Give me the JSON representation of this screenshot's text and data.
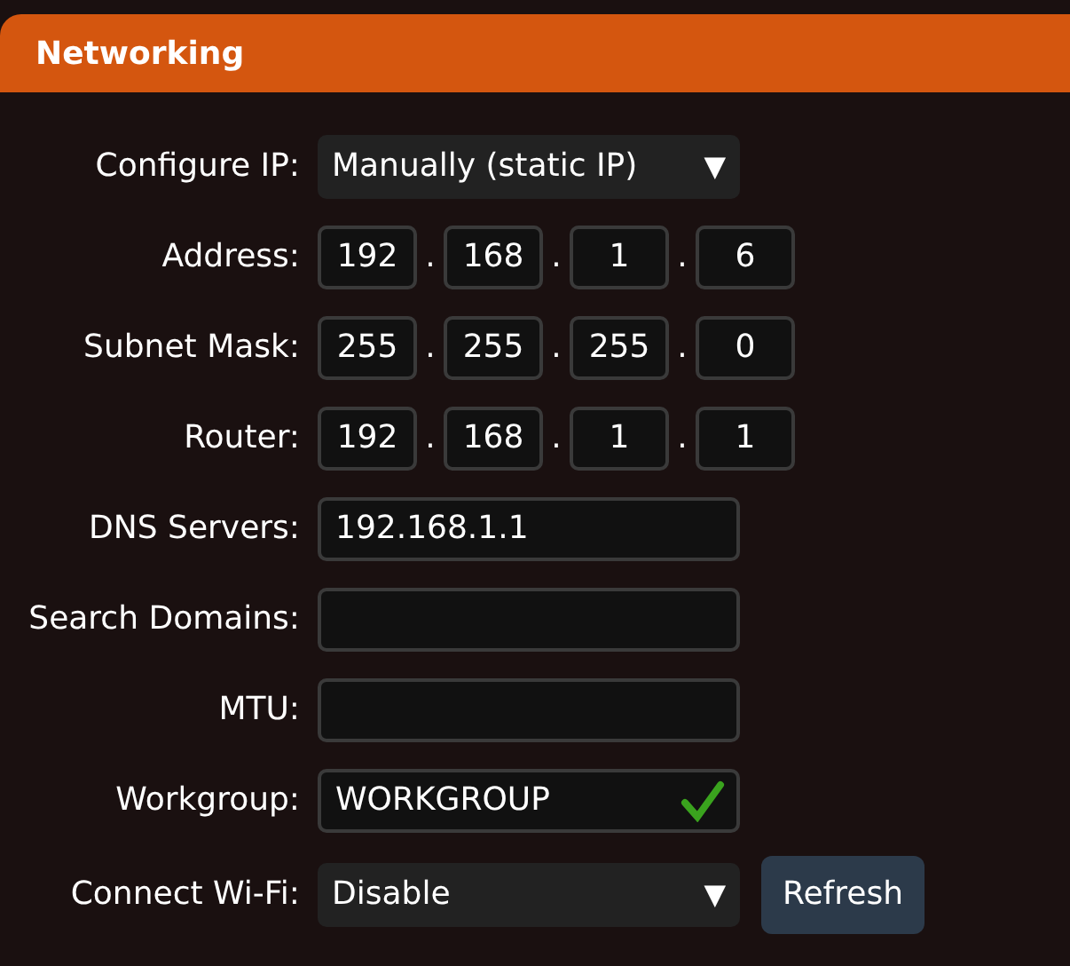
{
  "panel": {
    "title": "Networking"
  },
  "rows": [
    {
      "kind": "select",
      "label": "Configure IP:",
      "value": "Manually (static IP)",
      "arrow": "▼"
    },
    {
      "kind": "ip",
      "label": "Address:",
      "octets": [
        "192",
        "168",
        "1",
        "6"
      ],
      "separators": [
        ".",
        ".",
        "."
      ]
    },
    {
      "kind": "ip",
      "label": "Subnet Mask:",
      "octets": [
        "255",
        "255",
        "255",
        "0"
      ],
      "separators": [
        ".",
        ".",
        "."
      ]
    },
    {
      "kind": "ip",
      "label": "Router:",
      "octets": [
        "192",
        "168",
        "1",
        "1"
      ],
      "separators": [
        ".",
        ".",
        "."
      ]
    },
    {
      "kind": "text",
      "label": "DNS Servers:",
      "value": "192.168.1.1",
      "valid": false
    },
    {
      "kind": "text",
      "label": "Search Domains:",
      "value": "",
      "valid": false
    },
    {
      "kind": "text",
      "label": "MTU:",
      "value": "",
      "valid": false
    },
    {
      "kind": "text",
      "label": "Workgroup:",
      "value": "WORKGROUP",
      "valid": true
    },
    {
      "kind": "select",
      "label": "Connect Wi-Fi:",
      "value": "Disable",
      "arrow": "▼",
      "button": "Refresh"
    }
  ]
}
